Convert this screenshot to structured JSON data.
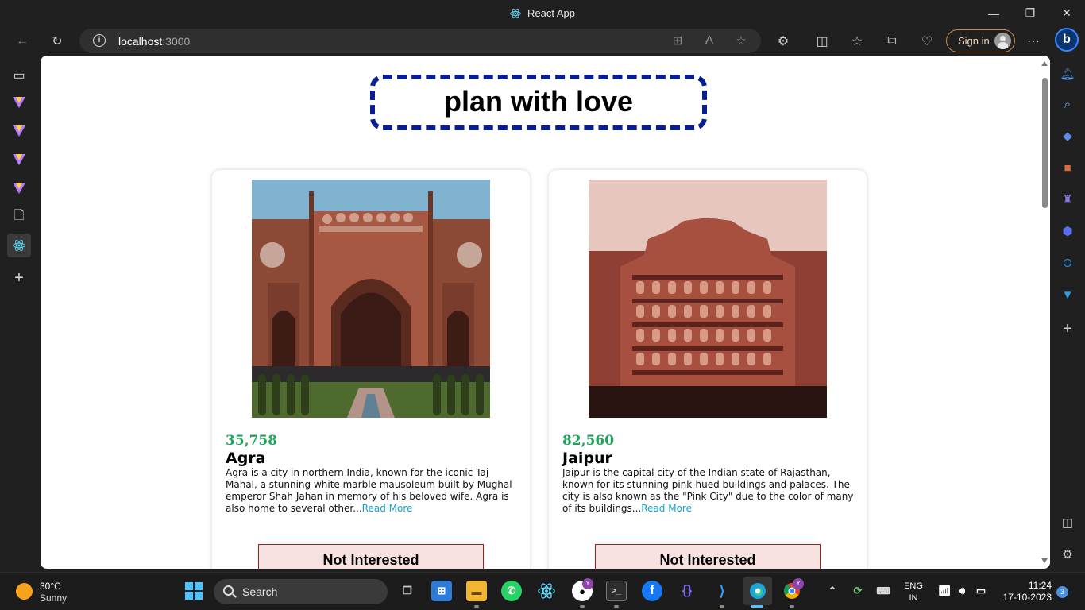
{
  "window": {
    "title": "React App"
  },
  "toolbar": {
    "url_host": "localhost",
    "url_port": ":3000",
    "signin_label": "Sign in"
  },
  "page": {
    "heading": "plan with love",
    "cards": [
      {
        "price": "35,758",
        "name": "Agra",
        "description": "Agra is a city in northern India, known for the iconic Taj Mahal, a stunning white marble mausoleum built by Mughal emperor Shah Jahan in memory of his beloved wife. Agra is also home to several other...",
        "read_more": "Read More",
        "button": "Not Interested"
      },
      {
        "price": "82,560",
        "name": "Jaipur",
        "description": "Jaipur is the capital city of the Indian state of Rajasthan, known for its stunning pink-hued buildings and palaces. The city is also known as the \"Pink City\" due to the color of many of its buildings...",
        "read_more": "Read More",
        "button": "Not Interested"
      }
    ]
  },
  "taskbar": {
    "weather_temp": "30°C",
    "weather_desc": "Sunny",
    "search_label": "Search",
    "lang_line1": "ENG",
    "lang_line2": "IN",
    "time": "11:24",
    "date": "17-10-2023",
    "notification_count": "3",
    "badge_a": "Y",
    "badge_b": "Y"
  },
  "colors": {
    "heading_border": "#0a1f8f",
    "price": "#1fa55b",
    "read_more": "#15a2c6",
    "button_bg": "#f8e1e1",
    "button_border": "#b01818"
  }
}
